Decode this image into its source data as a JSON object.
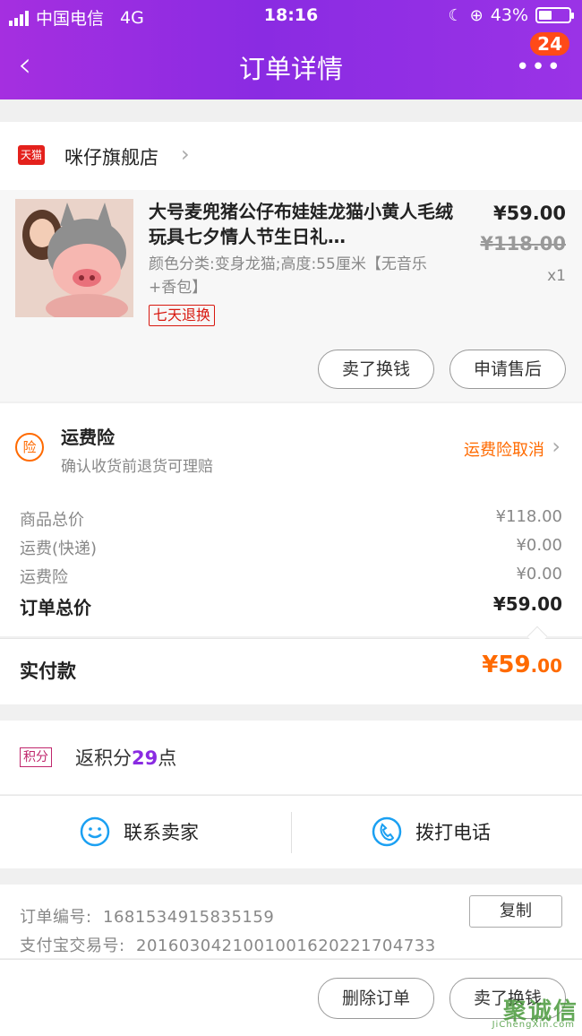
{
  "status_bar": {
    "carrier": "中国电信",
    "network": "4G",
    "time": "18:16",
    "battery": "43%",
    "battery_level": 0.43
  },
  "nav": {
    "back_icon": "‹",
    "title": "订单详情",
    "more_icon": "•••",
    "badge": "24"
  },
  "store": {
    "logo_text": "天猫",
    "name": "咪仔旗舰店",
    "chevron": "›"
  },
  "product": {
    "name": "大号麦兜猪公仔布娃娃龙猫小黄人毛绒玩具七夕情人节生日礼…",
    "sku": "颜色分类:变身龙猫;高度:55厘米【无音乐+香包】",
    "tag": "七天退换",
    "price": "¥59.00",
    "original_price": "¥118.00",
    "quantity": "x1",
    "btn_sell": "卖了换钱",
    "btn_after_sale": "申请售后"
  },
  "insurance": {
    "icon_text": "险",
    "title": "运费险",
    "desc": "确认收货前退货可理赔",
    "action": "运费险取消",
    "chevron": "›"
  },
  "summary": {
    "rows": [
      {
        "label": "商品总价",
        "value": "¥118.00"
      },
      {
        "label": "运费(快递)",
        "value": "¥0.00"
      },
      {
        "label": "运费险",
        "value": "¥0.00"
      }
    ],
    "total_label": "订单总价",
    "total_value": "¥59.00",
    "paid_label": "实付款",
    "paid_value_main": "¥59",
    "paid_value_dec": ".00"
  },
  "points": {
    "tag": "积分",
    "prefix": "返积分",
    "value": "29",
    "suffix": "点"
  },
  "contact": {
    "seller": "联系卖家",
    "phone": "拨打电话"
  },
  "order_info": {
    "order_no_label": "订单编号:",
    "order_no": "1681534915835159",
    "alipay_label": "支付宝交易号:",
    "alipay_no": "2016030421001001620221704733",
    "copy": "复制"
  },
  "footer": {
    "delete": "删除订单",
    "sell": "卖了换钱"
  },
  "watermark": {
    "main": "聚诚信",
    "sub": "JiChengXin.com"
  },
  "colors": {
    "header_purple": "#8a2be2",
    "accent_orange": "#ff6a00",
    "tag_red": "#d8180f",
    "badge_red": "#ff4a18"
  }
}
